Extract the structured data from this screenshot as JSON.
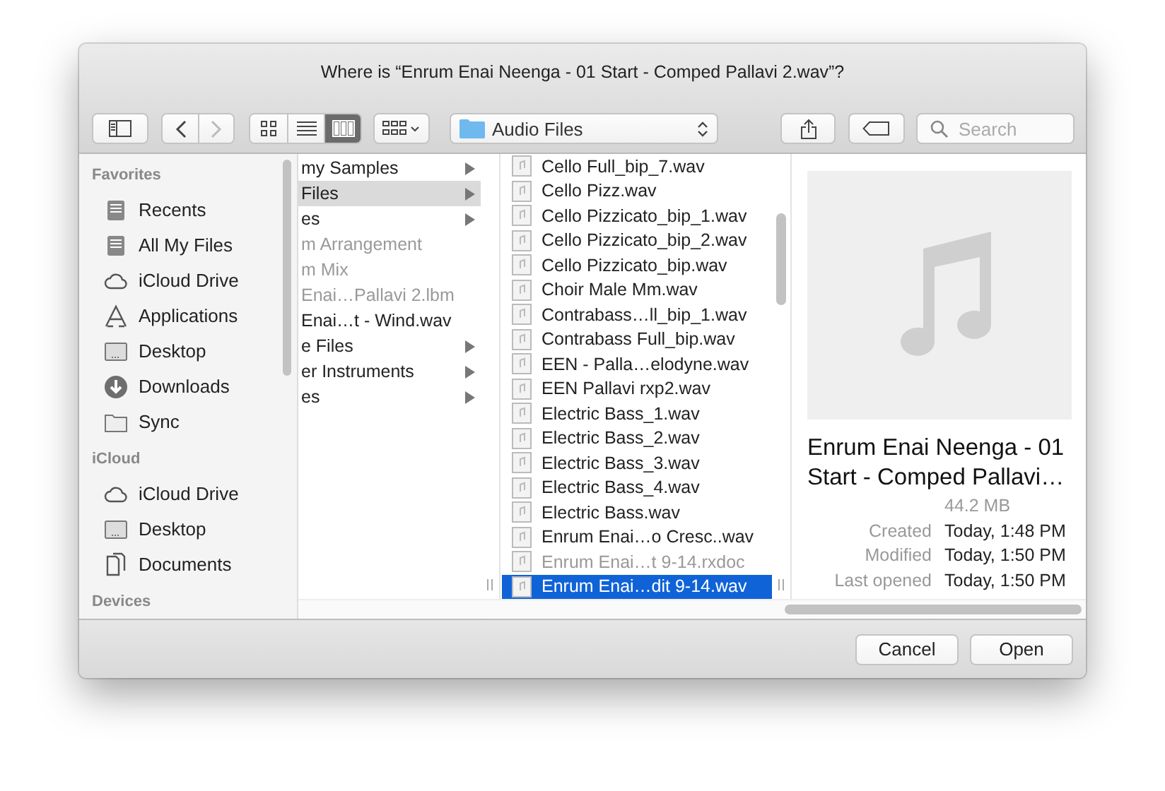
{
  "window": {
    "title": "Where is “Enrum Enai Neenga - 01 Start - Comped Pallavi 2.wav”?"
  },
  "toolbar": {
    "navigation": [
      {
        "kind": "back",
        "disabled": false
      },
      {
        "kind": "forward",
        "disabled": true
      }
    ],
    "view_modes": [
      {
        "kind": "icons",
        "selected": false
      },
      {
        "kind": "list",
        "selected": false
      },
      {
        "kind": "columns",
        "selected": true
      }
    ],
    "location": "Audio Files",
    "search": {
      "placeholder": "Search"
    }
  },
  "sidebar": {
    "sections": [
      {
        "heading": "Favorites",
        "items": [
          {
            "label": "Recents",
            "kind": "tray"
          },
          {
            "label": "All My Files",
            "kind": "tray"
          },
          {
            "label": "iCloud Drive",
            "kind": "cloud"
          },
          {
            "label": "Applications",
            "kind": "apps"
          },
          {
            "label": "Desktop",
            "kind": "desktop"
          },
          {
            "label": "Downloads",
            "kind": "download"
          },
          {
            "label": "Sync",
            "kind": "folder"
          }
        ]
      },
      {
        "heading": "iCloud",
        "items": [
          {
            "label": "iCloud Drive",
            "kind": "cloud"
          },
          {
            "label": "Desktop",
            "kind": "desktop"
          },
          {
            "label": "Documents",
            "kind": "documents"
          }
        ]
      },
      {
        "heading": "Devices"
      }
    ]
  },
  "column_1": [
    {
      "label": "my Samples",
      "kind": "folder",
      "disabled": false,
      "selected": false
    },
    {
      "label": "Files",
      "kind": "folder",
      "disabled": false,
      "selected": true
    },
    {
      "label": "es",
      "kind": "folder",
      "disabled": false,
      "selected": false
    },
    {
      "label": "m Arrangement",
      "kind": "file",
      "disabled": true,
      "selected": false
    },
    {
      "label": "m Mix",
      "kind": "file",
      "disabled": true,
      "selected": false
    },
    {
      "label": "Enai…Pallavi 2.lbm",
      "kind": "file",
      "disabled": true,
      "selected": false
    },
    {
      "label": "Enai…t - Wind.wav",
      "kind": "file",
      "disabled": false,
      "selected": false
    },
    {
      "label": "e Files",
      "kind": "folder",
      "disabled": false,
      "selected": false
    },
    {
      "label": "er Instruments",
      "kind": "folder",
      "disabled": false,
      "selected": false
    },
    {
      "label": "es",
      "kind": "folder",
      "disabled": false,
      "selected": false
    }
  ],
  "column_2": [
    {
      "label": "Cello Full_bip_7.wav",
      "disabled": false,
      "selected": false
    },
    {
      "label": "Cello Pizz.wav",
      "disabled": false,
      "selected": false
    },
    {
      "label": "Cello Pizzicato_bip_1.wav",
      "disabled": false,
      "selected": false
    },
    {
      "label": "Cello Pizzicato_bip_2.wav",
      "disabled": false,
      "selected": false
    },
    {
      "label": "Cello Pizzicato_bip.wav",
      "disabled": false,
      "selected": false
    },
    {
      "label": "Choir Male Mm.wav",
      "disabled": false,
      "selected": false
    },
    {
      "label": "Contrabass…ll_bip_1.wav",
      "disabled": false,
      "selected": false
    },
    {
      "label": "Contrabass Full_bip.wav",
      "disabled": false,
      "selected": false
    },
    {
      "label": "EEN - Palla…elodyne.wav",
      "disabled": false,
      "selected": false
    },
    {
      "label": "EEN Pallavi rxp2.wav",
      "disabled": false,
      "selected": false
    },
    {
      "label": "Electric Bass_1.wav",
      "disabled": false,
      "selected": false
    },
    {
      "label": "Electric Bass_2.wav",
      "disabled": false,
      "selected": false
    },
    {
      "label": "Electric Bass_3.wav",
      "disabled": false,
      "selected": false
    },
    {
      "label": "Electric Bass_4.wav",
      "disabled": false,
      "selected": false
    },
    {
      "label": "Electric Bass.wav",
      "disabled": false,
      "selected": false
    },
    {
      "label": "Enrum Enai…o Cresc..wav",
      "disabled": false,
      "selected": false
    },
    {
      "label": "Enrum Enai…t 9-14.rxdoc",
      "disabled": true,
      "selected": false
    },
    {
      "label": "Enrum Enai…dit 9-14.wav",
      "disabled": false,
      "selected": true
    }
  ],
  "preview": {
    "name_lines": [
      "Enrum Enai Neenga - 01",
      "Start - Comped Pallavi…"
    ],
    "size": "44.2 MB",
    "details": [
      {
        "label": "Created",
        "value": "Today, 1:48 PM"
      },
      {
        "label": "Modified",
        "value": "Today, 1:50 PM"
      },
      {
        "label": "Last opened",
        "value": "Today, 1:50 PM"
      }
    ]
  },
  "buttons": [
    {
      "label": "Cancel"
    },
    {
      "label": "Open"
    }
  ]
}
